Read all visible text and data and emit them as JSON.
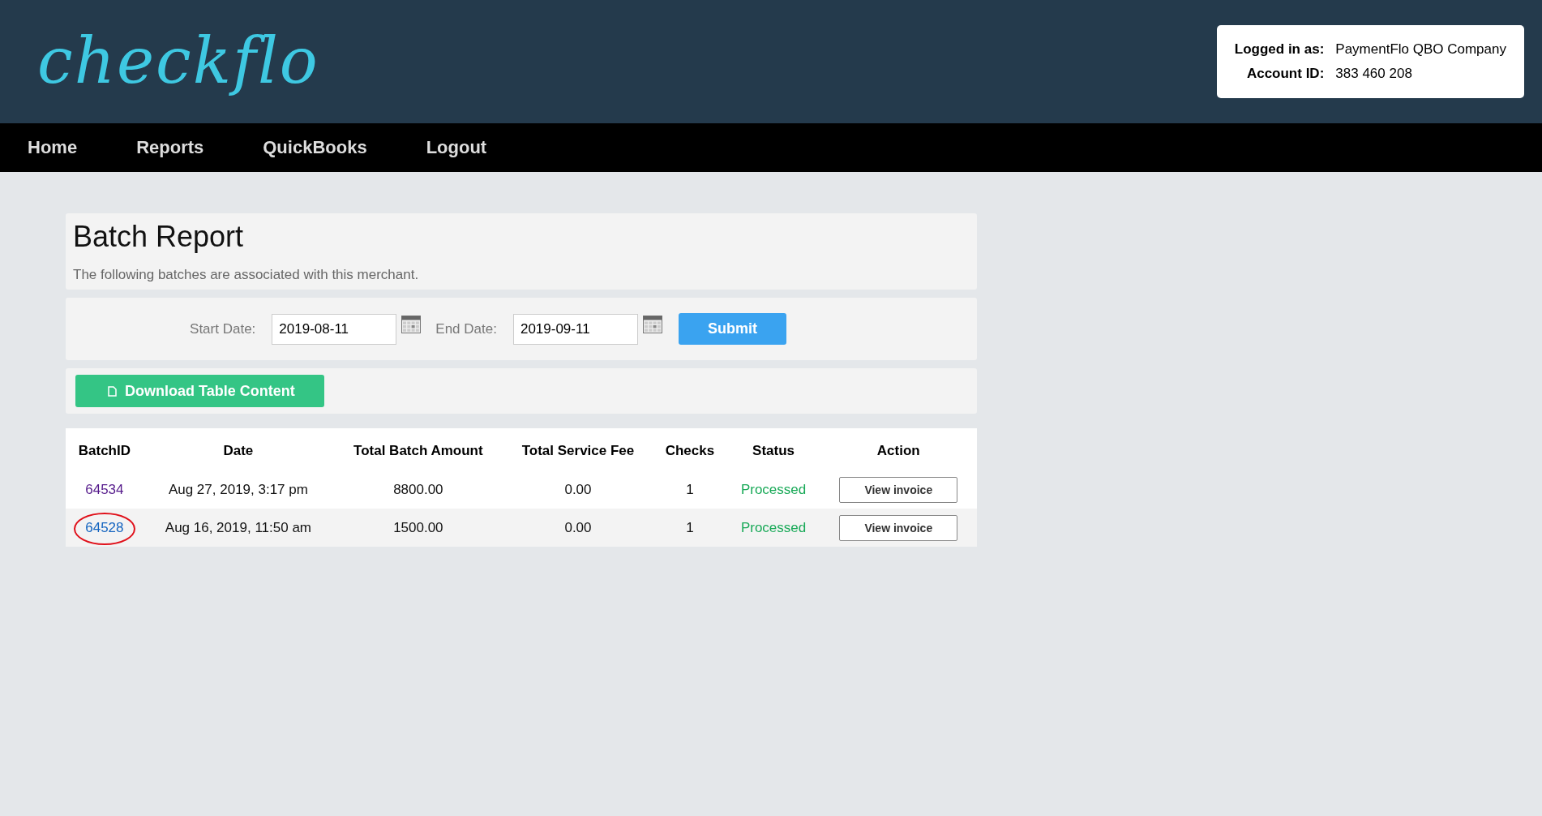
{
  "logo": {
    "text": "checkflo"
  },
  "account": [
    {
      "label": "Logged in as:",
      "value": "PaymentFlo QBO Company"
    },
    {
      "label": "Account ID:",
      "value": "383 460 208"
    }
  ],
  "nav": [
    {
      "label": "Home"
    },
    {
      "label": "Reports"
    },
    {
      "label": "QuickBooks"
    },
    {
      "label": "Logout"
    }
  ],
  "report": {
    "title": "Batch Report",
    "description": "The following batches are associated with this merchant."
  },
  "filters": [
    {
      "label": "Start Date:",
      "value": "2019-08-11"
    },
    {
      "label": "End Date:",
      "value": "2019-09-11"
    }
  ],
  "submit": "Submit",
  "download": "Download Table Content",
  "table": {
    "columns": [
      "BatchID",
      "Date",
      "Total Batch Amount",
      "Total Service Fee",
      "Checks",
      "Status",
      "Action"
    ],
    "rows": [
      {
        "batch_id": "64534",
        "visited": true,
        "circled": false,
        "date": "Aug 27, 2019, 3:17 pm",
        "amount": "8800.00",
        "fee": "0.00",
        "checks": "1",
        "status": "Processed",
        "action": "View invoice"
      },
      {
        "batch_id": "64528",
        "visited": false,
        "circled": true,
        "date": "Aug 16, 2019, 11:50 am",
        "amount": "1500.00",
        "fee": "0.00",
        "checks": "1",
        "status": "Processed",
        "action": "View invoice"
      }
    ]
  }
}
